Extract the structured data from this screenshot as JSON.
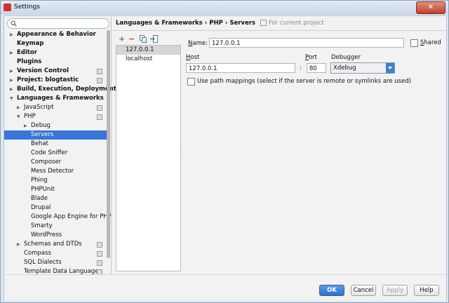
{
  "window": {
    "title": "Settings"
  },
  "search": {
    "placeholder": ""
  },
  "sidebar": {
    "items": [
      {
        "label": "Appearance & Behavior",
        "bold": true,
        "arrow": "right",
        "indent": 0
      },
      {
        "label": "Keymap",
        "bold": true,
        "arrow": "",
        "indent": 0
      },
      {
        "label": "Editor",
        "bold": true,
        "arrow": "right",
        "indent": 0
      },
      {
        "label": "Plugins",
        "bold": true,
        "arrow": "",
        "indent": 0
      },
      {
        "label": "Version Control",
        "bold": true,
        "arrow": "right",
        "indent": 0,
        "project": true
      },
      {
        "label": "Project: blogtastic",
        "bold": true,
        "arrow": "right",
        "indent": 0,
        "project": true
      },
      {
        "label": "Build, Execution, Deployment",
        "bold": true,
        "arrow": "right",
        "indent": 0
      },
      {
        "label": "Languages & Frameworks",
        "bold": true,
        "arrow": "down",
        "indent": 0
      },
      {
        "label": "JavaScript",
        "bold": false,
        "arrow": "right",
        "indent": 1,
        "project": true
      },
      {
        "label": "PHP",
        "bold": false,
        "arrow": "down",
        "indent": 1,
        "project": true
      },
      {
        "label": "Debug",
        "bold": false,
        "arrow": "right",
        "indent": 2
      },
      {
        "label": "Servers",
        "bold": false,
        "arrow": "",
        "indent": 2,
        "selected": true
      },
      {
        "label": "Behat",
        "bold": false,
        "arrow": "",
        "indent": 2
      },
      {
        "label": "Code Sniffer",
        "bold": false,
        "arrow": "",
        "indent": 2
      },
      {
        "label": "Composer",
        "bold": false,
        "arrow": "",
        "indent": 2
      },
      {
        "label": "Mess Detector",
        "bold": false,
        "arrow": "",
        "indent": 2
      },
      {
        "label": "Phing",
        "bold": false,
        "arrow": "",
        "indent": 2
      },
      {
        "label": "PHPUnit",
        "bold": false,
        "arrow": "",
        "indent": 2
      },
      {
        "label": "Blade",
        "bold": false,
        "arrow": "",
        "indent": 2
      },
      {
        "label": "Drupal",
        "bold": false,
        "arrow": "",
        "indent": 2
      },
      {
        "label": "Google App Engine for PHP",
        "bold": false,
        "arrow": "",
        "indent": 2
      },
      {
        "label": "Smarty",
        "bold": false,
        "arrow": "",
        "indent": 2
      },
      {
        "label": "WordPress",
        "bold": false,
        "arrow": "",
        "indent": 2
      },
      {
        "label": "Schemas and DTDs",
        "bold": false,
        "arrow": "right",
        "indent": 1,
        "project": true
      },
      {
        "label": "Compass",
        "bold": false,
        "arrow": "",
        "indent": 1,
        "project": true
      },
      {
        "label": "SQL Dialects",
        "bold": false,
        "arrow": "",
        "indent": 1,
        "project": true
      },
      {
        "label": "Template Data Languages",
        "bold": false,
        "arrow": "",
        "indent": 1,
        "project": true
      }
    ]
  },
  "breadcrumb": {
    "parts": [
      "Languages & Frameworks",
      "PHP",
      "Servers"
    ],
    "separator": "›",
    "scope": "For current project"
  },
  "server_list": {
    "items": [
      "127.0.0.1",
      "localhost"
    ],
    "selected_index": 0
  },
  "form": {
    "name_label": "Name:",
    "name_value": "127.0.0.1",
    "shared_label": "Shared",
    "shared_checked": false,
    "host_label": "Host",
    "host_value": "127.0.0.1",
    "colon": ":",
    "port_label": "Port",
    "port_value": "80",
    "debugger_label": "Debugger",
    "debugger_value": "Xdebug",
    "path_mappings_label": "Use path mappings (select if the server is remote or symlinks are used)",
    "path_mappings_checked": false
  },
  "footer": {
    "ok": "OK",
    "cancel": "Cancel",
    "apply": "Apply",
    "help": "Help"
  },
  "colors": {
    "selection": "#3875d7",
    "add_icon": "#3a9a3a",
    "remove_icon": "#d03a2a",
    "accent_button": "#2f6fca"
  }
}
